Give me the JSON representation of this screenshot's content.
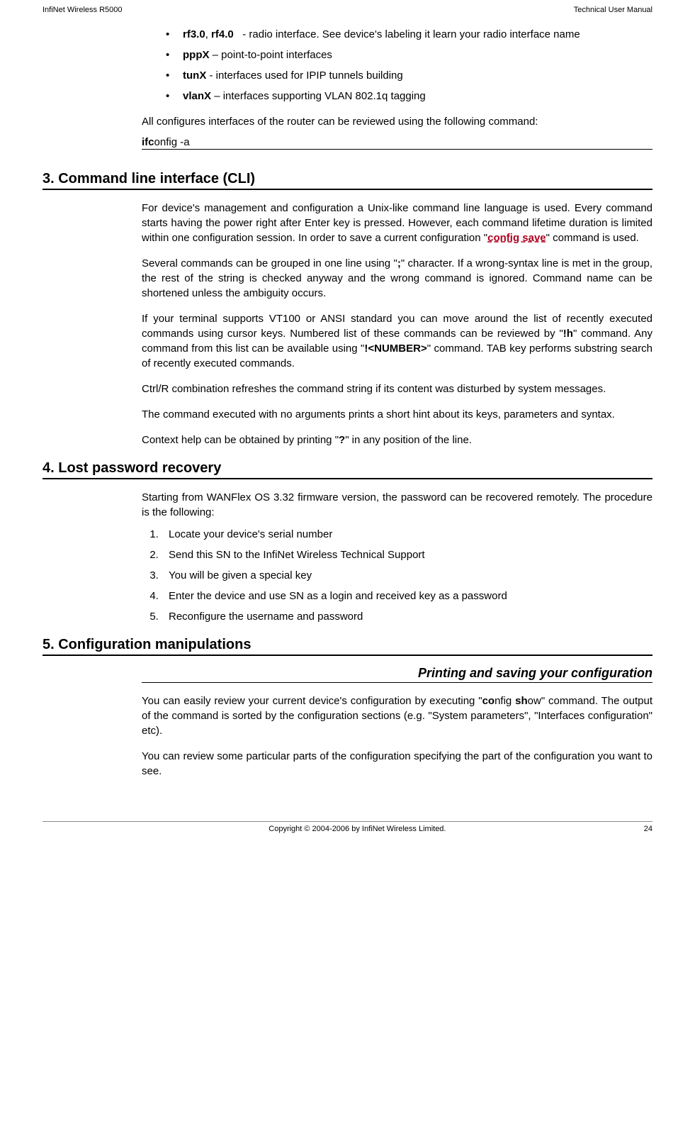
{
  "header": {
    "left": "InfiNet Wireless R5000",
    "right": "Technical User Manual"
  },
  "intro": {
    "bullets": [
      {
        "bold1": "rf3.0",
        "bold2": "rf4.0",
        "rest": " - radio interface. See device's labeling it learn your radio interface name"
      },
      {
        "bold1": "pppX",
        "rest": " – point-to-point interfaces"
      },
      {
        "bold1": "tunX",
        "rest": " -  interfaces used for IPIP tunnels building"
      },
      {
        "bold1": "vlanX",
        "rest": " – interfaces supporting VLAN 802.1q tagging"
      }
    ],
    "para1": "All configures interfaces of the router can be reviewed using the following command:",
    "cmd_bold": "ifc",
    "cmd_rest": "onfig -a"
  },
  "section3": {
    "title": "3. Command line interface (CLI)",
    "p1_a": "For device's management and configuration a Unix-like command line language is used. Every command starts having the power right after Enter key is pressed. However, each command lifetime duration is limited within one configuration session. In order to save a current configuration \"",
    "p1_link": "config save",
    "p1_b": "\" command is used.",
    "p2_a": "Several commands can be grouped in one line using \"",
    "p2_bold": ";",
    "p2_b": "\" character. If a wrong-syntax line is met in the group, the rest of the string is checked anyway and the wrong command is ignored. Command name can be shortened unless the ambiguity occurs.",
    "p3_a": "If your terminal supports VT100 or ANSI standard you can move around the list of recently executed commands using cursor keys. Numbered list of these commands can be reviewed by \"",
    "p3_bold1": "!h",
    "p3_b": "\" command. Any command from this list can be available using \"",
    "p3_bold2": "!<NUMBER>",
    "p3_c": "\" command. TAB key performs substring search of recently executed commands.",
    "p4": "Ctrl/R combination refreshes the command string if its content was disturbed by system messages.",
    "p5": "The command executed with no arguments prints a short hint about its keys, parameters and syntax.",
    "p6_a": "Context help can be obtained by printing \"",
    "p6_bold": "?",
    "p6_b": "\" in any position of the line."
  },
  "section4": {
    "title": "4. Lost password recovery",
    "p1": "Starting from WANFlex OS 3.32 firmware version, the password can be recovered remotely. The procedure is the following:",
    "items": [
      "Locate your device's serial number",
      "Send this SN to the InfiNet Wireless Technical Support",
      "You will be given a special key",
      "Enter the device and use SN as a login and received key as a password",
      "Reconfigure the username and password"
    ]
  },
  "section5": {
    "title": "5. Configuration manipulations",
    "sub1": "Printing and saving your configuration",
    "p1_a": "You can easily review your current device's configuration by executing \"",
    "p1_bold1": "co",
    "p1_mid1": "nfig ",
    "p1_bold2": "sh",
    "p1_b": "ow\" command. The output of the command is sorted by the configuration sections (e.g. \"System parameters\", \"Interfaces configuration\" etc).",
    "p2": "You can review some particular parts of the configuration specifying the part of the configuration you want to see."
  },
  "footer": {
    "copyright": "Copyright © 2004-2006 by InfiNet Wireless Limited.",
    "page": "24"
  }
}
